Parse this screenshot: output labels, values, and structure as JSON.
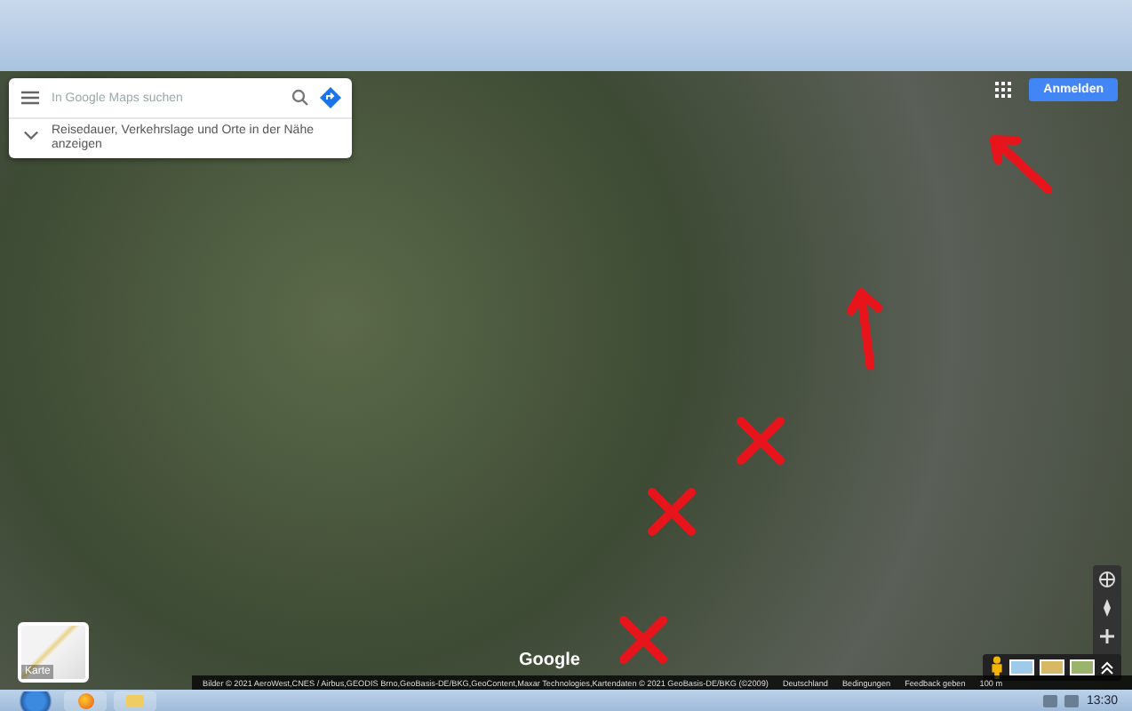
{
  "search": {
    "placeholder": "In Google Maps suchen",
    "hint": "Reisedauer, Verkehrslage und Orte in der Nähe anzeigen"
  },
  "header": {
    "sign_in": "Anmelden"
  },
  "map": {
    "layer_label": "Karte",
    "logo": "Google"
  },
  "footer": {
    "attribution": "Bilder © 2021 AeroWest,CNES / Airbus,GEODIS Brno,GeoBasis-DE/BKG,GeoContent,Maxar Technologies,Kartendaten © 2021 GeoBasis-DE/BKG (©2009)",
    "links": [
      "Deutschland",
      "Bedingungen",
      "Feedback geben"
    ],
    "scale": "100 m"
  },
  "annotations": [
    {
      "kind": "arrow"
    },
    {
      "kind": "arrow"
    },
    {
      "kind": "cross"
    },
    {
      "kind": "cross"
    },
    {
      "kind": "cross"
    }
  ],
  "taskbar": {
    "time": "13:30"
  }
}
